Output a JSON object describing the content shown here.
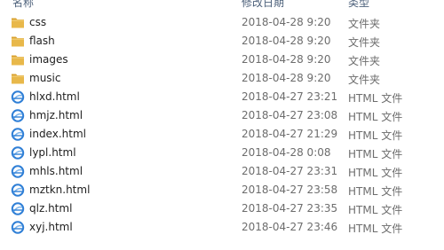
{
  "header": {
    "name_label": "名称",
    "date_label": "修改日期",
    "type_label": "类型"
  },
  "files": [
    {
      "name": "css",
      "date": "2018-04-28 9:20",
      "type": "文件夹",
      "icon": "folder-icon"
    },
    {
      "name": "flash",
      "date": "2018-04-28 9:20",
      "type": "文件夹",
      "icon": "folder-icon"
    },
    {
      "name": "images",
      "date": "2018-04-28 9:20",
      "type": "文件夹",
      "icon": "folder-icon"
    },
    {
      "name": "music",
      "date": "2018-04-28 9:20",
      "type": "文件夹",
      "icon": "folder-icon"
    },
    {
      "name": "hlxd.html",
      "date": "2018-04-27 23:21",
      "type": "HTML 文件",
      "icon": "html-file-icon"
    },
    {
      "name": "hmjz.html",
      "date": "2018-04-27 23:08",
      "type": "HTML 文件",
      "icon": "html-file-icon"
    },
    {
      "name": "index.html",
      "date": "2018-04-27 21:29",
      "type": "HTML 文件",
      "icon": "html-file-icon"
    },
    {
      "name": "lypl.html",
      "date": "2018-04-28 0:08",
      "type": "HTML 文件",
      "icon": "html-file-icon"
    },
    {
      "name": "mhls.html",
      "date": "2018-04-27 23:31",
      "type": "HTML 文件",
      "icon": "html-file-icon"
    },
    {
      "name": "mztkn.html",
      "date": "2018-04-27 23:58",
      "type": "HTML 文件",
      "icon": "html-file-icon"
    },
    {
      "name": "qlz.html",
      "date": "2018-04-27 23:35",
      "type": "HTML 文件",
      "icon": "html-file-icon"
    },
    {
      "name": "xyj.html",
      "date": "2018-04-27 23:46",
      "type": "HTML 文件",
      "icon": "html-file-icon"
    }
  ],
  "colors": {
    "folder": "#e8b84a",
    "folder_dark": "#d9a12e",
    "html_icon": "#2f7fd6"
  }
}
